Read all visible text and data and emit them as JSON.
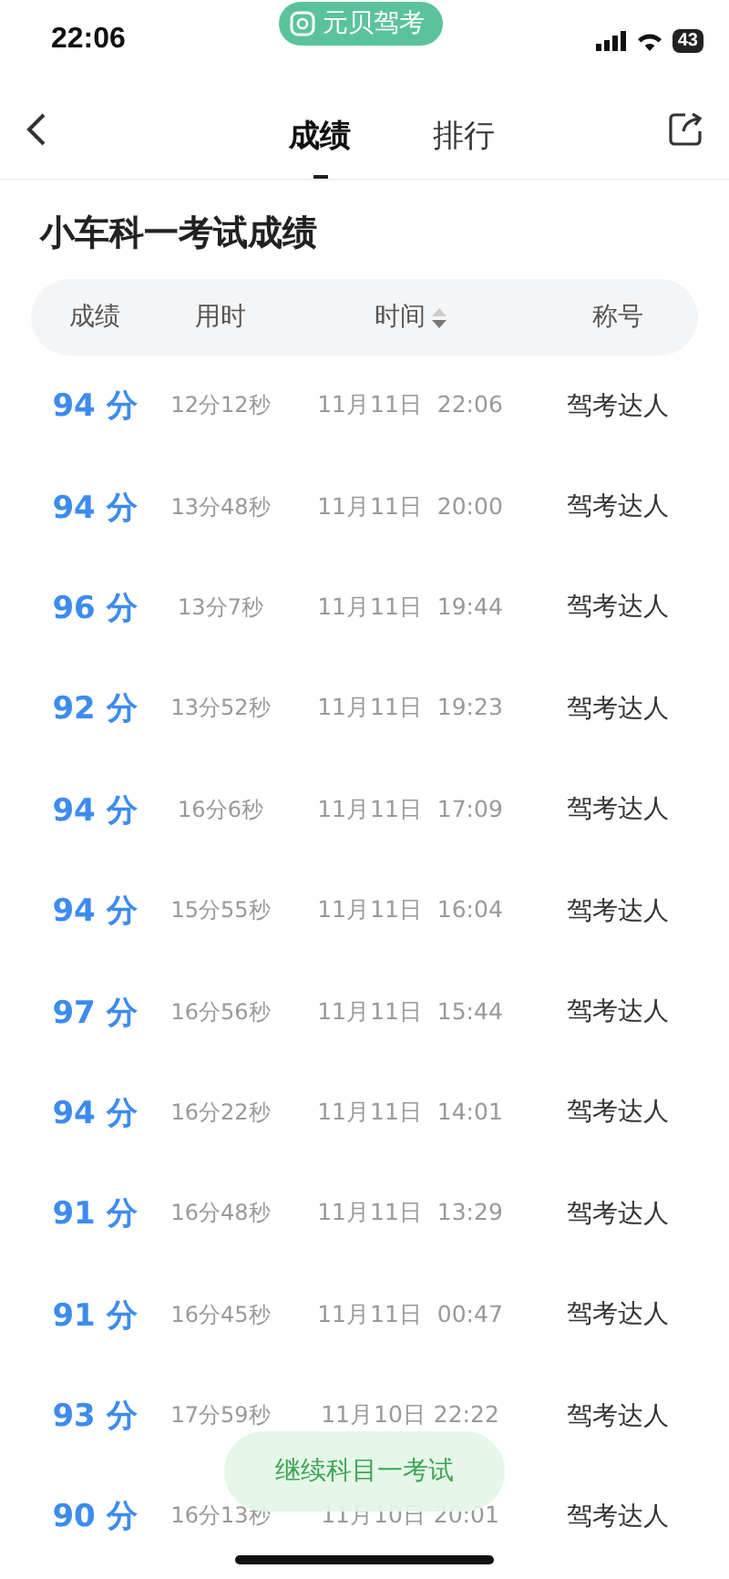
{
  "status_bar": {
    "time": "22:06",
    "app_pill": "元贝驾考",
    "battery": "43"
  },
  "nav": {
    "tabs": [
      {
        "label": "成绩",
        "selected": true
      },
      {
        "label": "排行",
        "selected": false
      }
    ]
  },
  "title": "小车科一考试成绩",
  "table": {
    "columns": [
      {
        "label": "成绩",
        "sortable": false
      },
      {
        "label": "用时",
        "sortable": false
      },
      {
        "label": "时间",
        "sortable": true
      },
      {
        "label": "称号",
        "sortable": false
      }
    ],
    "rows": [
      {
        "score": "94 分",
        "duration": "12分12秒",
        "time": "11月11日  22:06",
        "rank": "驾考达人"
      },
      {
        "score": "94 分",
        "duration": "13分48秒",
        "time": "11月11日  20:00",
        "rank": "驾考达人"
      },
      {
        "score": "96 分",
        "duration": "13分7秒",
        "time": "11月11日  19:44",
        "rank": "驾考达人"
      },
      {
        "score": "92 分",
        "duration": "13分52秒",
        "time": "11月11日  19:23",
        "rank": "驾考达人"
      },
      {
        "score": "94 分",
        "duration": "16分6秒",
        "time": "11月11日  17:09",
        "rank": "驾考达人"
      },
      {
        "score": "94 分",
        "duration": "15分55秒",
        "time": "11月11日  16:04",
        "rank": "驾考达人"
      },
      {
        "score": "97 分",
        "duration": "16分56秒",
        "time": "11月11日  15:44",
        "rank": "驾考达人"
      },
      {
        "score": "94 分",
        "duration": "16分22秒",
        "time": "11月11日  14:01",
        "rank": "驾考达人"
      },
      {
        "score": "91 分",
        "duration": "16分48秒",
        "time": "11月11日  13:29",
        "rank": "驾考达人"
      },
      {
        "score": "91 分",
        "duration": "16分45秒",
        "time": "11月11日  00:47",
        "rank": "驾考达人"
      },
      {
        "score": "93 分",
        "duration": "17分59秒",
        "time": "11月10日 22:22",
        "rank": "驾考达人"
      },
      {
        "score": "90 分",
        "duration": "16分13秒",
        "time": "11月10日 20:01",
        "rank": "驾考达人"
      }
    ]
  },
  "continue_button": "继续科目一考试"
}
